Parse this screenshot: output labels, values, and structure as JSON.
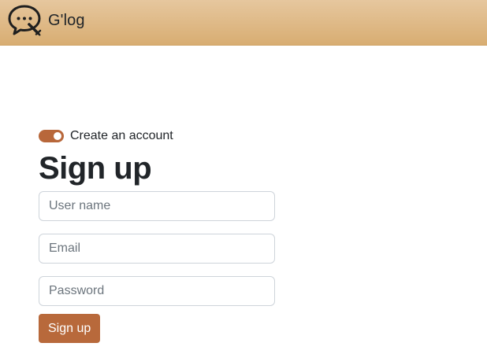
{
  "navbar": {
    "brand_name": "G'log",
    "logo_icon": "chat-bubble-pencil-icon",
    "background_color": "#dfba86"
  },
  "form": {
    "toggle_label": "Create an account",
    "toggle_on": true,
    "title": "Sign up",
    "fields": {
      "username_placeholder": "User name",
      "email_placeholder": "Email",
      "password_placeholder": "Password"
    },
    "submit_label": "Sign up"
  },
  "colors": {
    "accent": "#b8693b",
    "text": "#212529",
    "placeholder": "#6c757d",
    "field_border": "#ced4da"
  }
}
